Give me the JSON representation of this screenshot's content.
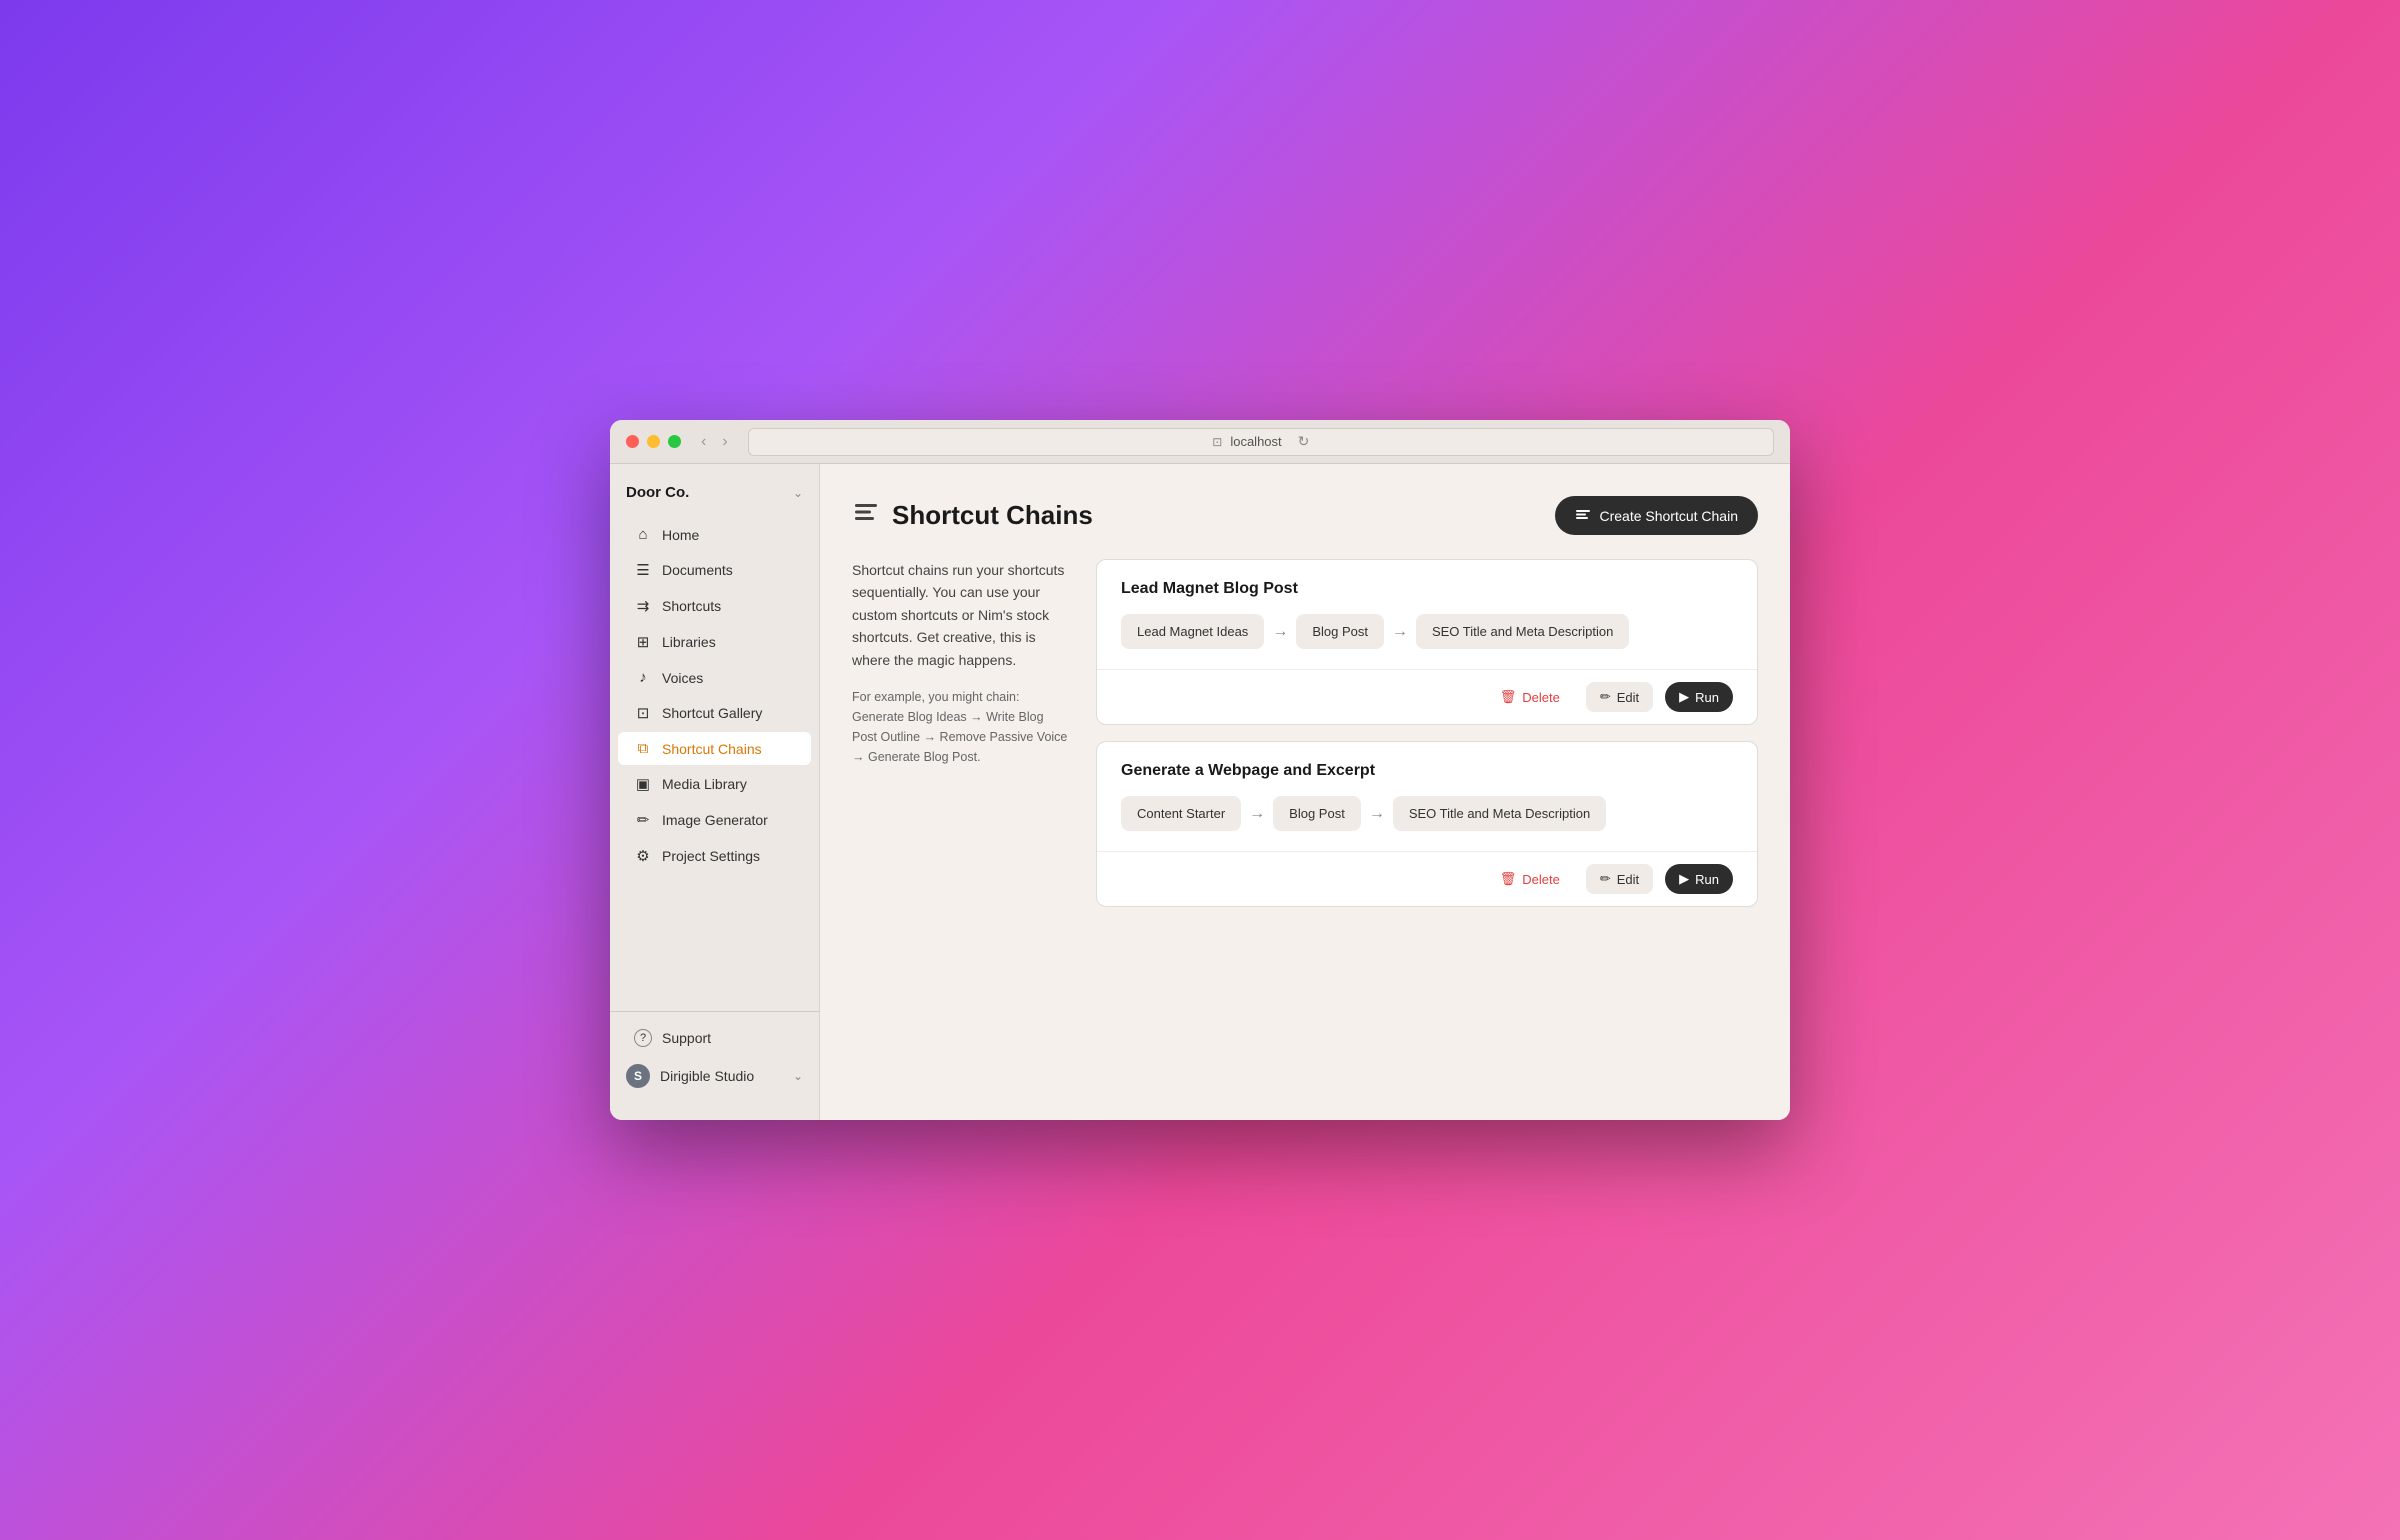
{
  "browser": {
    "url": "localhost",
    "nav_back": "‹",
    "nav_forward": "›",
    "refresh": "↻"
  },
  "sidebar": {
    "brand": "Door Co.",
    "brand_chevron": "⌄",
    "nav_items": [
      {
        "id": "home",
        "label": "Home",
        "icon": "⌂",
        "active": false
      },
      {
        "id": "documents",
        "label": "Documents",
        "icon": "☰",
        "active": false
      },
      {
        "id": "shortcuts",
        "label": "Shortcuts",
        "icon": "⇉",
        "active": false
      },
      {
        "id": "libraries",
        "label": "Libraries",
        "icon": "⊞",
        "active": false
      },
      {
        "id": "voices",
        "label": "Voices",
        "icon": "♪",
        "active": false
      },
      {
        "id": "shortcut-gallery",
        "label": "Shortcut Gallery",
        "icon": "⊡",
        "active": false
      },
      {
        "id": "shortcut-chains",
        "label": "Shortcut Chains",
        "icon": "⧉",
        "active": true
      },
      {
        "id": "media-library",
        "label": "Media Library",
        "icon": "▣",
        "active": false
      },
      {
        "id": "image-generator",
        "label": "Image Generator",
        "icon": "✏",
        "active": false
      },
      {
        "id": "project-settings",
        "label": "Project Settings",
        "icon": "⚙",
        "active": false
      }
    ],
    "support": {
      "label": "Support",
      "icon": "?"
    },
    "workspace": {
      "avatar_letter": "S",
      "name": "Dirigible Studio",
      "chevron": "⌄"
    }
  },
  "page": {
    "icon": "☰",
    "title": "Shortcut Chains",
    "create_button": "Create Shortcut Chain",
    "create_icon": "≡",
    "description": "Shortcut chains run your shortcuts sequentially. You can use your custom shortcuts or Nim's stock shortcuts. Get creative, this is where the magic happens.",
    "example_label": "For example, you might chain: Generate Blog Ideas → Write Blog Post Outline → Remove Passive Voice → Generate Blog Post."
  },
  "chains": [
    {
      "id": "chain-1",
      "title": "Lead Magnet Blog Post",
      "steps": [
        {
          "label": "Lead Magnet Ideas"
        },
        {
          "label": "Blog Post"
        },
        {
          "label": "SEO Title and Meta Description"
        }
      ],
      "delete_label": "Delete",
      "edit_label": "Edit",
      "run_label": "Run"
    },
    {
      "id": "chain-2",
      "title": "Generate a Webpage and Excerpt",
      "steps": [
        {
          "label": "Content Starter"
        },
        {
          "label": "Blog Post"
        },
        {
          "label": "SEO Title and Meta Description"
        }
      ],
      "delete_label": "Delete",
      "edit_label": "Edit",
      "run_label": "Run"
    }
  ]
}
